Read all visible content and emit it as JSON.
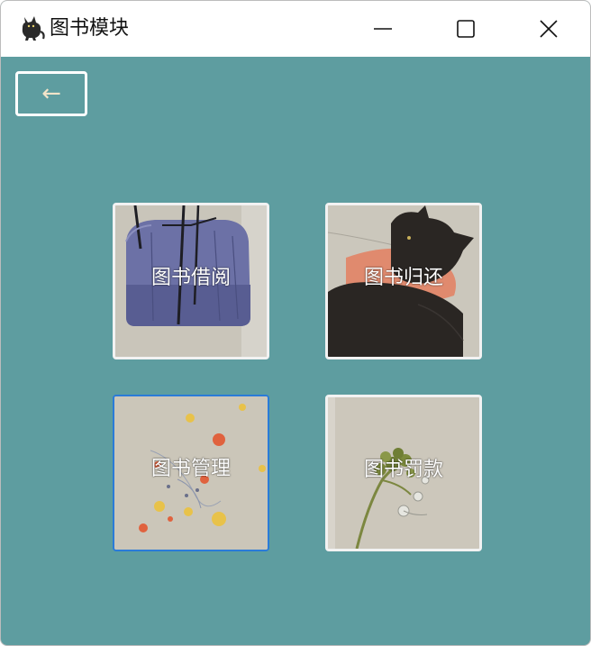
{
  "window": {
    "title": "图书模块",
    "icon": "black-cat-icon",
    "controls": [
      "minimize-icon",
      "maximize-icon",
      "close-icon"
    ]
  },
  "toolbar": {
    "back_label": "←"
  },
  "tiles": [
    {
      "label": "图书借阅",
      "art": "glass-bottle-image"
    },
    {
      "label": "图书归还",
      "art": "black-cat-image"
    },
    {
      "label": "图书管理",
      "art": "scattered-flowers-image"
    },
    {
      "label": "图书罚款",
      "art": "green-flower-sprig-image"
    }
  ],
  "colors": {
    "background": "#5e9da0",
    "titlebar": "#ffffff",
    "tile_border": "#f2f2f2",
    "focus_border": "#2a7bd8",
    "back_arrow": "#f2e4c9"
  }
}
